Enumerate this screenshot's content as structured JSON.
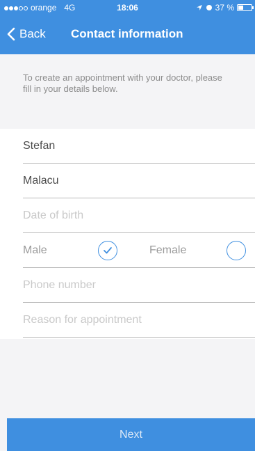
{
  "status": {
    "carrier": "orange",
    "network": "4G",
    "time": "18:06",
    "battery_text": "37 %",
    "battery_level": 0.37
  },
  "nav": {
    "back_label": "Back",
    "title": "Contact information"
  },
  "intro_text": "To create an appointment with your doctor, please fill in your details below.",
  "form": {
    "first_name": {
      "value": "Stefan"
    },
    "last_name": {
      "value": "Malacu"
    },
    "date_of_birth": {
      "placeholder": "Date of birth"
    },
    "gender": {
      "male_label": "Male",
      "female_label": "Female",
      "selected": "male"
    },
    "phone": {
      "placeholder": "Phone number"
    },
    "reason": {
      "placeholder": "Reason for appointment"
    }
  },
  "next_label": "Next",
  "colors": {
    "accent": "#3f8fe0",
    "background": "#f4f4f6"
  }
}
